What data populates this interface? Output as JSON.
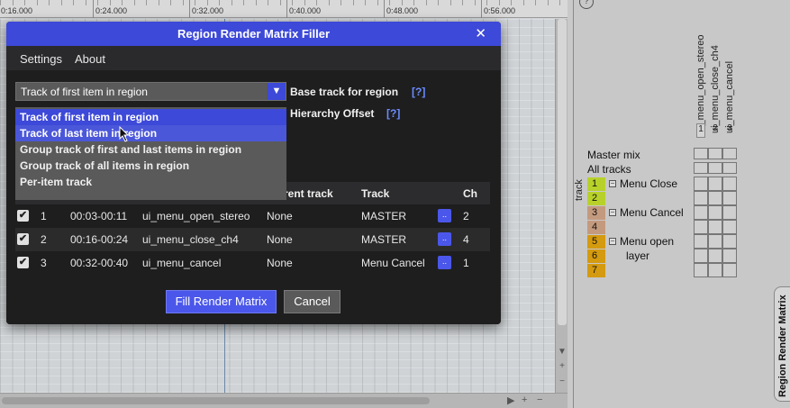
{
  "ruler": {
    "ticks": [
      "0:16.000",
      "0:24.000",
      "0:32.000",
      "0:40.000",
      "0:48.000",
      "0:56.000"
    ]
  },
  "dialog": {
    "title": "Region Render Matrix Filler",
    "close_glyph": "✕",
    "menu": [
      "Settings",
      "About"
    ],
    "base_track": {
      "selected": "Track of first item in region",
      "label": "Base track for region",
      "help": "[?]",
      "options": [
        "Track of first item in region",
        "Track of last item in region",
        "Group track of first and last items in region",
        "Group track of all items in region",
        "Per-item track"
      ]
    },
    "hierarchy_offset": {
      "label": "Hierarchy Offset",
      "help": "[?]"
    },
    "table": {
      "headers": [
        "rent track",
        "Track",
        "Ch"
      ],
      "rows": [
        {
          "checked": true,
          "num": "1",
          "time": "00:03-00:11",
          "region": "ui_menu_open_stereo",
          "current": "None",
          "track": "MASTER",
          "dots": "..",
          "ch": "2"
        },
        {
          "checked": true,
          "num": "2",
          "time": "00:16-00:24",
          "region": "ui_menu_close_ch4",
          "current": "None",
          "track": "MASTER",
          "dots": "..",
          "ch": "4"
        },
        {
          "checked": true,
          "num": "3",
          "time": "00:32-00:40",
          "region": "ui_menu_cancel",
          "current": "None",
          "track": "Menu Cancel",
          "dots": "..",
          "ch": "1"
        }
      ]
    },
    "fill_button": "Fill Render Matrix",
    "cancel_button": "Cancel"
  },
  "render_matrix": {
    "help": "?",
    "columns": [
      {
        "num": "1",
        "name": "ui_menu_open_stereo"
      },
      {
        "num": "2",
        "name": "ui_menu_close_ch4"
      },
      {
        "num": "3",
        "name": "ui_menu_cancel"
      }
    ],
    "master_mix": "Master mix",
    "all_tracks": "All tracks",
    "track_axis": "track",
    "tracks": [
      {
        "num": "1",
        "color": "#b8d12a",
        "name": "Menu Close",
        "folder": true
      },
      {
        "num": "2",
        "color": "#b8d12a",
        "name": ""
      },
      {
        "num": "3",
        "color": "#c49a7e",
        "name": "Menu Cancel",
        "folder": true
      },
      {
        "num": "4",
        "color": "#c49a7e",
        "name": ""
      },
      {
        "num": "5",
        "color": "#d49a10",
        "name": "Menu open",
        "folder": true
      },
      {
        "num": "6",
        "color": "#d49a10",
        "name": "layer"
      },
      {
        "num": "7",
        "color": "#d49a10",
        "name": ""
      }
    ],
    "side_tab": "Region Render Matrix"
  }
}
